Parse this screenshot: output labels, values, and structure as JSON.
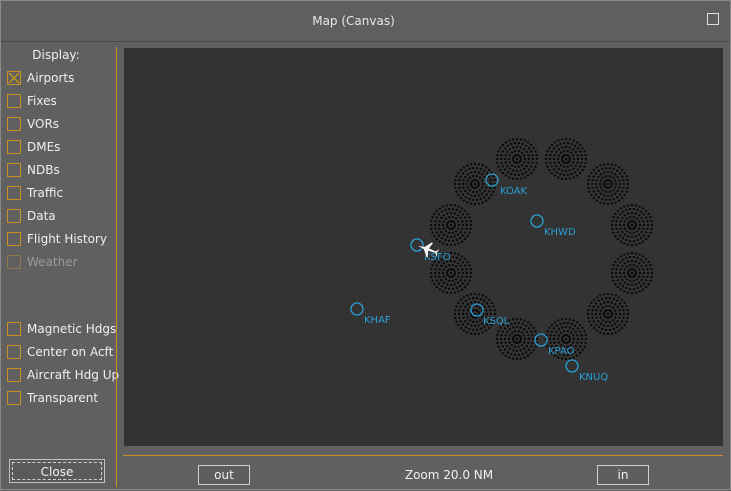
{
  "window": {
    "title": "Map (Canvas)"
  },
  "display_label": "Display:",
  "checkboxes": [
    {
      "label": "Airports",
      "checked": true,
      "enabled": true
    },
    {
      "label": "Fixes",
      "checked": false,
      "enabled": true
    },
    {
      "label": "VORs",
      "checked": false,
      "enabled": true
    },
    {
      "label": "DMEs",
      "checked": false,
      "enabled": true
    },
    {
      "label": "NDBs",
      "checked": false,
      "enabled": true
    },
    {
      "label": "Traffic",
      "checked": false,
      "enabled": true
    },
    {
      "label": "Data",
      "checked": false,
      "enabled": true
    },
    {
      "label": "Flight History",
      "checked": false,
      "enabled": true
    },
    {
      "label": "Weather",
      "checked": false,
      "enabled": false
    }
  ],
  "options": [
    {
      "label": "Magnetic Hdgs",
      "checked": false
    },
    {
      "label": "Center on Acft",
      "checked": false
    },
    {
      "label": "Aircraft Hdg Up",
      "checked": false
    },
    {
      "label": "Transparent",
      "checked": false
    }
  ],
  "close_label": "Close",
  "zoom": {
    "out_label": "out",
    "in_label": "in",
    "text": "Zoom 20.0 NM"
  },
  "map": {
    "airports": [
      "KOAK",
      "KHWD",
      "KSFO",
      "KHAF",
      "KSQL",
      "KPAO",
      "KNUQ"
    ],
    "colors": {
      "airport": "#2a9fd6",
      "accent": "#c89020",
      "canvas": "#333333"
    }
  }
}
